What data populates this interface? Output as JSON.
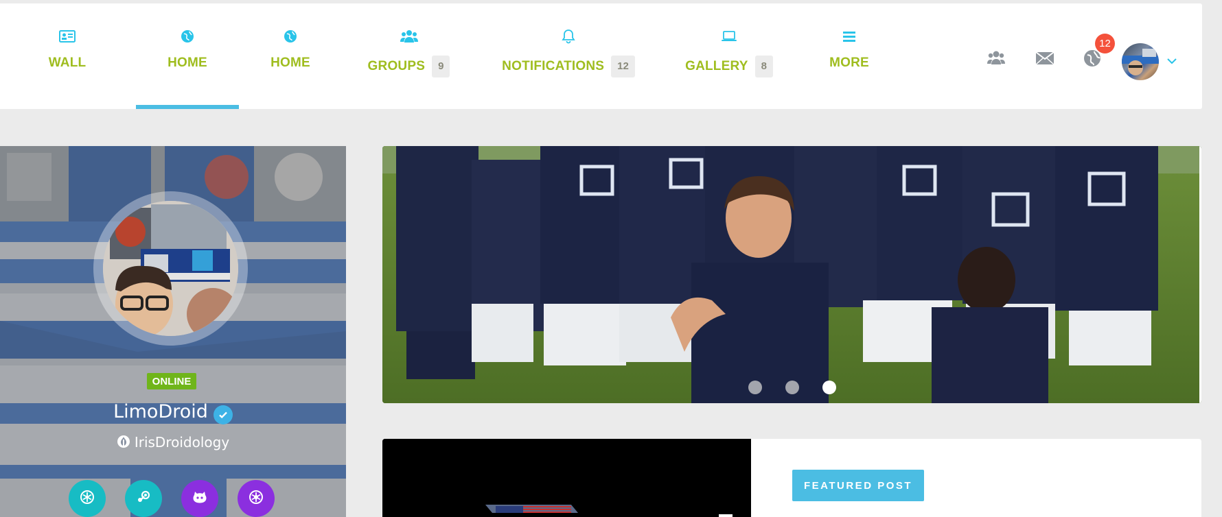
{
  "nav": {
    "items": [
      {
        "label": "WALL",
        "badge": "",
        "icon": "id-card-icon"
      },
      {
        "label": "HOME",
        "badge": "",
        "icon": "globe-icon"
      },
      {
        "label": "HOME",
        "badge": "",
        "icon": "globe-icon"
      },
      {
        "label": "GROUPS",
        "badge": "9",
        "icon": "users-icon"
      },
      {
        "label": "NOTIFICATIONS",
        "badge": "12",
        "icon": "bell-icon"
      },
      {
        "label": "GALLERY",
        "badge": "8",
        "icon": "laptop-icon"
      },
      {
        "label": "MORE",
        "badge": "",
        "icon": "menu-icon"
      }
    ],
    "active_index": 1,
    "label_color": "#9fbd1f",
    "accent_color": "#4bbde3"
  },
  "toolbar": {
    "notifications_count": "12",
    "badge_color": "#f4513b"
  },
  "profile": {
    "status": "ONLINE",
    "name": "LimoDroid",
    "handle": "IrisDroidology",
    "status_color": "#6fb51a",
    "socials": [
      {
        "icon": "snowflake-icon",
        "color": "#17bcc4"
      },
      {
        "icon": "steam-icon",
        "color": "#17bcc4"
      },
      {
        "icon": "github-icon",
        "color": "#8b2fdf"
      },
      {
        "icon": "dribbble-icon",
        "color": "#8b2fdf"
      }
    ]
  },
  "slider": {
    "slides": 3,
    "active": 3
  },
  "post": {
    "featured_label": "FEATURED POST"
  }
}
